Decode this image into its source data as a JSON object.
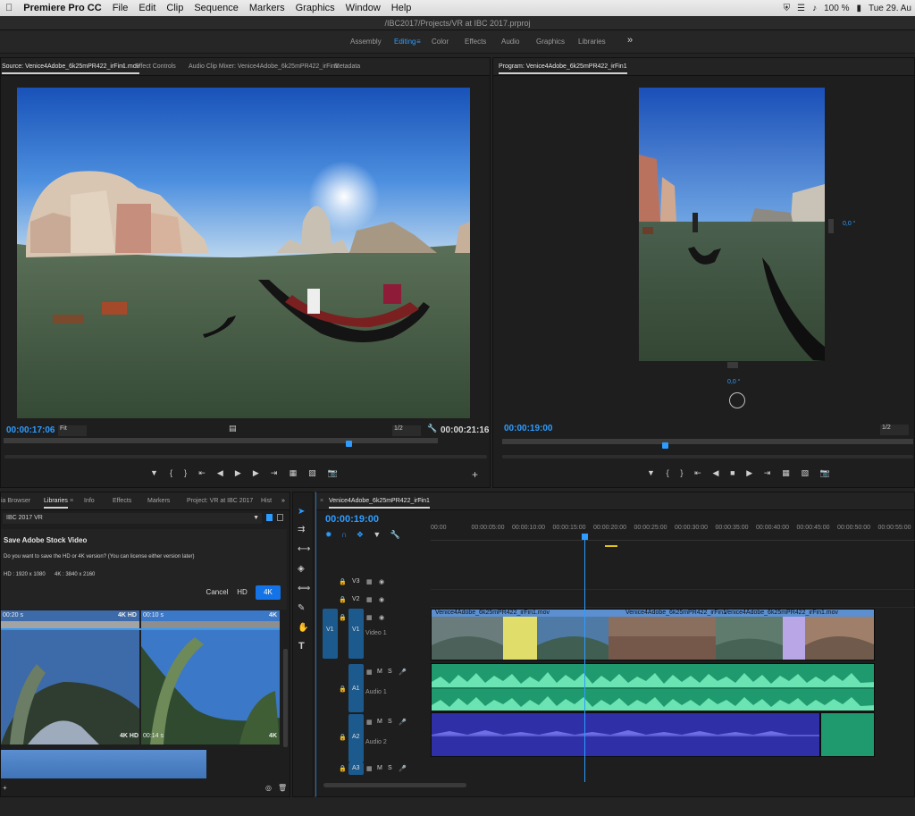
{
  "menubar": {
    "apple_icon": "apple-icon",
    "app_name": "Premiere Pro CC",
    "items": [
      "File",
      "Edit",
      "Clip",
      "Sequence",
      "Markers",
      "Graphics",
      "Window",
      "Help"
    ],
    "battery": "100 %",
    "datetime": "Tue 29. Au"
  },
  "titlebar": {
    "path": "/IBC2017/Projects/VR at IBC 2017.prproj"
  },
  "workspaces": {
    "items": [
      "Assembly",
      "Editing",
      "Color",
      "Effects",
      "Audio",
      "Graphics",
      "Libraries"
    ],
    "active": "Editing",
    "more": "»"
  },
  "source_panel": {
    "tabs": [
      "Source: Venice4Adobe_6k25mPR422_irFin1.mov",
      "Effect Controls",
      "Audio Clip Mixer: Venice4Adobe_6k25mPR422_irFin1",
      "Metadata"
    ],
    "timecode_in": "00:00:17:06",
    "zoom": "Fit",
    "resolution": "1/2",
    "timecode_dur": "00:00:21:16"
  },
  "program_panel": {
    "tab": "Program: Venice4Adobe_6k25mPR422_irFin1",
    "angle_right": "0,0 °",
    "angle_bottom": "0,0 °",
    "timecode": "00:00:19:00",
    "resolution": "1/2"
  },
  "libraries_panel": {
    "tabs": [
      "ia Browser",
      "Libraries",
      "Info",
      "Effects",
      "Markers",
      "Project: VR at IBC 2017",
      "Hist"
    ],
    "library_select": "IBC 2017 VR",
    "dialog_title": "Save Adobe Stock Video",
    "dialog_text": "Do you want to save the HD or 4K version? (You can license either version later)",
    "res_hd": "HD : 1920 x 1080",
    "res_4k": "4K : 3840 x 2160",
    "cancel": "Cancel",
    "hd": "HD",
    "fourk": "4K",
    "thumbs": [
      {
        "dur": "00:20 s",
        "badge": "4K  HD"
      },
      {
        "dur": "00:10 s",
        "badge": "4K"
      },
      {
        "dur": "",
        "badge": "4K  HD"
      },
      {
        "dur": "00:14 s",
        "badge": "4K"
      }
    ]
  },
  "timeline": {
    "tab": "Venice4Adobe_6k25mPR422_irFin1",
    "timecode": "00:00:19:00",
    "ruler": [
      "00:00",
      "00:00:05:00",
      "00:00:10:00",
      "00:00:15:00",
      "00:00:20:00",
      "00:00:25:00",
      "00:00:30:00",
      "00:00:35:00",
      "00:00:40:00",
      "00:00:45:00",
      "00:00:50:00",
      "00:00:55:00"
    ],
    "tracks": {
      "v3": "V3",
      "v2": "V2",
      "v1": "V1",
      "v1_src": "V1",
      "video1": "Video 1",
      "a1": "A1",
      "audio1": "Audio 1",
      "a2": "A2",
      "audio2": "Audio 2",
      "a3": "A3",
      "m": "M",
      "s": "S"
    },
    "clips": [
      "Venice4Adobe_6k25mPR422_irFin1.mov",
      "Venice4Adobe_6k25mPR422_irFin1",
      "Venice4Adobe_6k25mPR422_irFin1.mov"
    ]
  },
  "colors": {
    "accent": "#2d9cff",
    "audio_green": "#1f9a6e",
    "audio_blue": "#2f2fa8",
    "clip_yellow": "#e1dd6b",
    "clip_purple": "#b8a6e6",
    "clip_video": "#5b8fd0"
  }
}
